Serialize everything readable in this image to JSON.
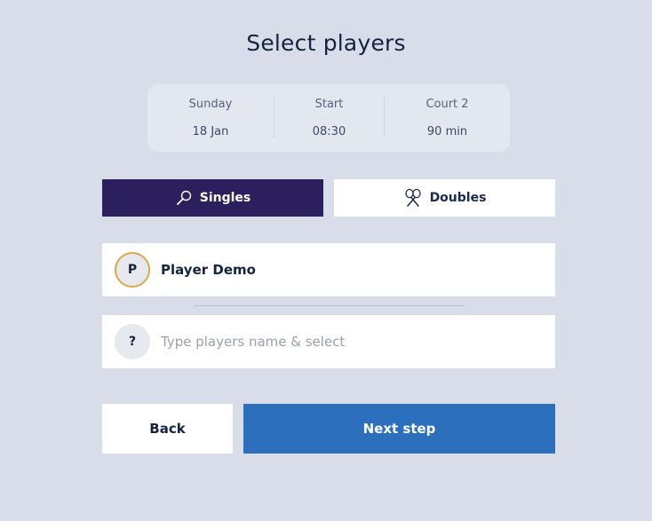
{
  "header": {
    "title": "Select players"
  },
  "booking": {
    "day": "Sunday",
    "date": "18 Jan",
    "start_label": "Start",
    "start_time": "08:30",
    "court": "Court 2",
    "duration": "90 min"
  },
  "mode": {
    "singles_label": "Singles",
    "doubles_label": "Doubles",
    "selected": "Singles",
    "singles_icon": "racket-icon",
    "doubles_icon": "crossed-rackets-icon"
  },
  "players": {
    "player1": {
      "initial": "P",
      "name": "Player Demo"
    },
    "player2": {
      "initial": "?",
      "placeholder": "Type players name & select",
      "value": ""
    }
  },
  "actions": {
    "back_label": "Back",
    "next_label": "Next step"
  },
  "colors": {
    "background": "#d8dde9",
    "singles_active": "#2c1f5e",
    "next_button": "#2c6fbd",
    "avatar_ring": "#d9a94a"
  }
}
